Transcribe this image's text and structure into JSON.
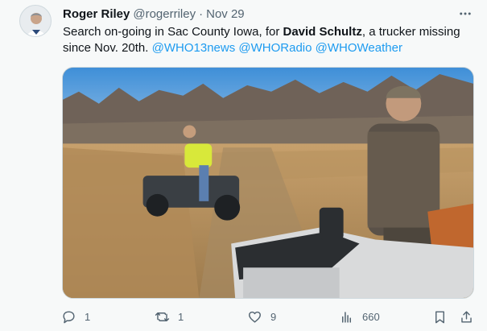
{
  "author": {
    "display_name": "Roger Riley",
    "handle": "@rogerriley",
    "separator": "·",
    "date": "Nov 29"
  },
  "tweet": {
    "text_before": "Search on-going in Sac County Iowa, for ",
    "text_bold": "David Schultz",
    "text_after": ", a trucker missing since Nov. 20th. ",
    "mentions": [
      "@WHO13news",
      "@WHORadio",
      "@WHOWeather"
    ]
  },
  "media": {
    "description_icon": "video-still-icon"
  },
  "actions": {
    "reply_count": "1",
    "retweet_count": "1",
    "like_count": "9",
    "views_count": "660"
  },
  "colors": {
    "accent": "#1d9bf0",
    "secondary_text": "#536471",
    "background": "#f7f9f9"
  }
}
